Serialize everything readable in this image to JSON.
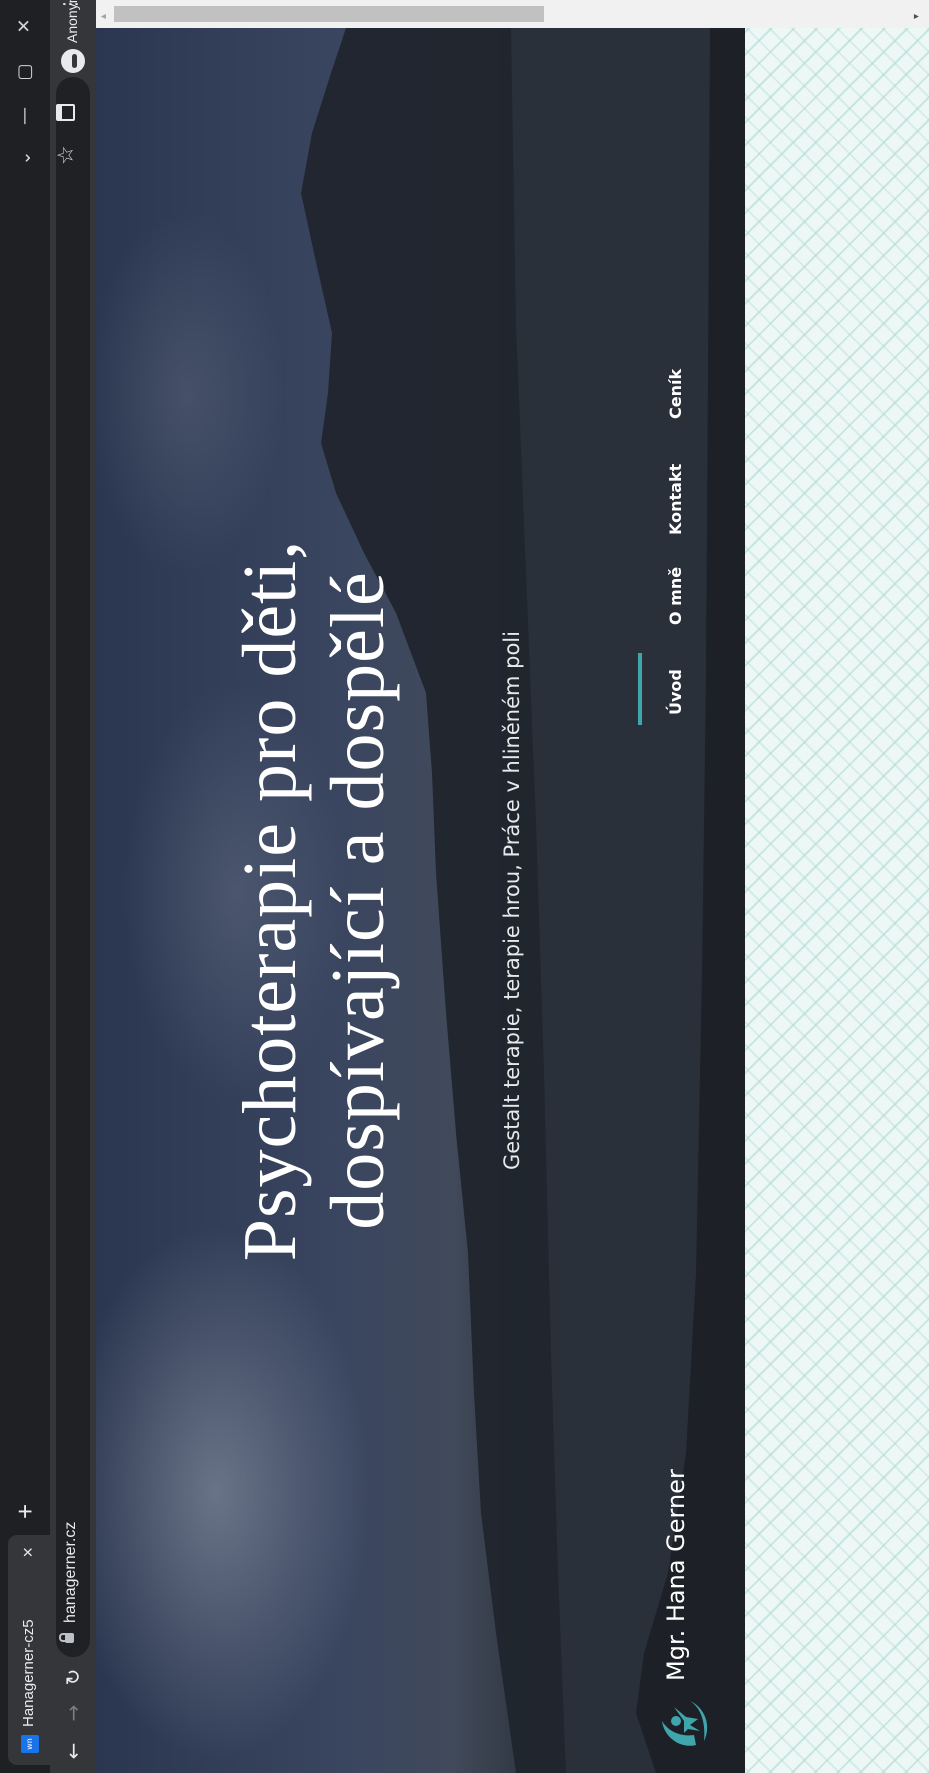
{
  "browser": {
    "tab": {
      "favicon_text": "wn",
      "title": "Hanagerner-cz5",
      "close": "×"
    },
    "new_tab": "+",
    "window_controls": {
      "tab_search": "⌄",
      "minimize": "—",
      "restore": "▢",
      "close": "✕"
    },
    "nav": {
      "back": "←",
      "forward": "→",
      "reload": "↻"
    },
    "url": "hanagerner.cz",
    "bookmark_icon": "☆",
    "profile_label": "Anonymní",
    "menu": "⋮"
  },
  "site": {
    "brand_name": "Mgr. Hana Gerner",
    "nav": [
      "Úvod",
      "O mně",
      "Kontakt",
      "Ceník"
    ],
    "active_nav": "Úvod",
    "hero": {
      "title_line1": "Psychoterapie pro děti,",
      "title_line2": "dospívající a dospělé",
      "subtitle": "Gestalt terapie, terapie hrou, Práce v hliněném poli"
    },
    "colors": {
      "accent": "#3fa6ac",
      "pattern_bg": "#edf7f5"
    }
  },
  "scrollbar": {
    "up": "▴",
    "down": "▾"
  }
}
